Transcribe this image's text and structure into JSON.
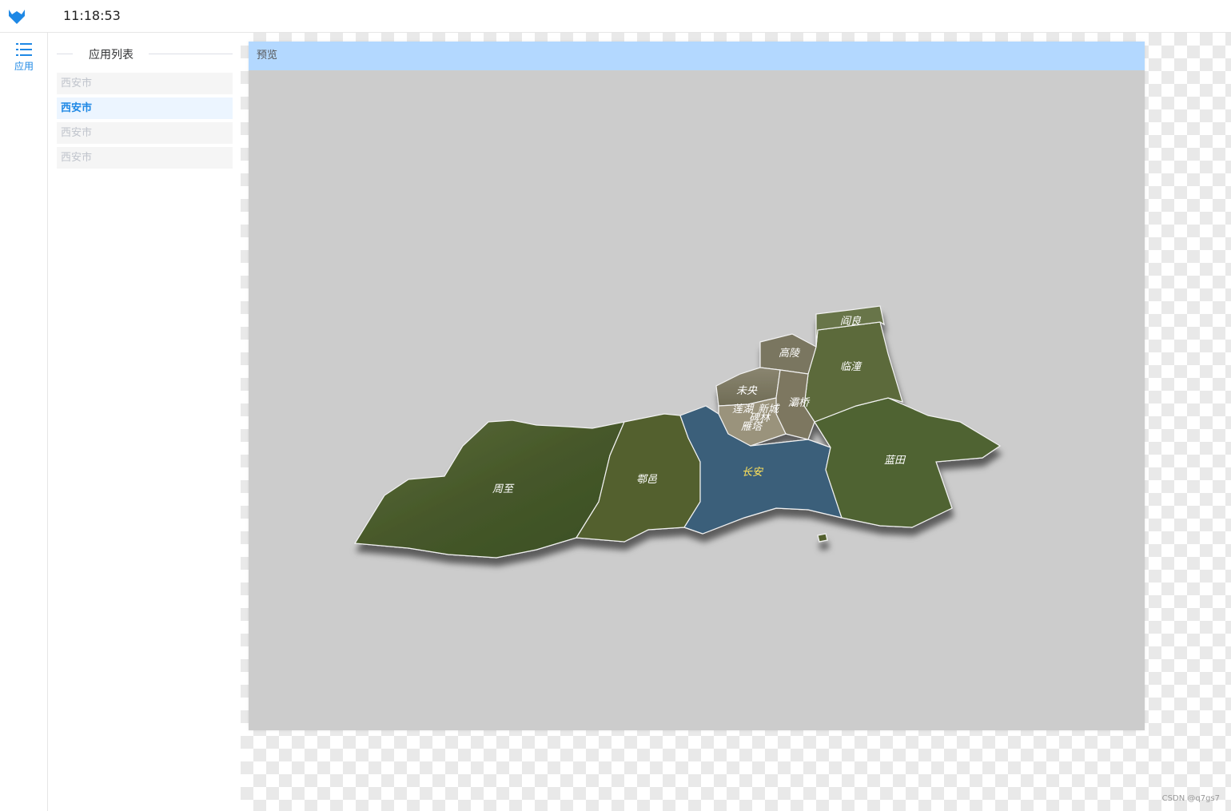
{
  "header": {
    "time": "11:18:53",
    "logo": "fox-logo-icon"
  },
  "sidebar": {
    "nav_label": "应用",
    "nav_icon": "list-icon"
  },
  "app_list": {
    "title": "应用列表",
    "items": [
      {
        "label": "西安市",
        "active": false
      },
      {
        "label": "西安市",
        "active": true
      },
      {
        "label": "西安市",
        "active": false
      },
      {
        "label": "西安市",
        "active": false
      }
    ]
  },
  "preview": {
    "title": "预览",
    "map": {
      "districts": [
        "阎良",
        "高陵",
        "临潼",
        "未央",
        "灞桥",
        "莲湖",
        "新城",
        "碑林",
        "雁塔",
        "周至",
        "鄠邑",
        "长安",
        "蓝田"
      ],
      "selected": "长安"
    }
  },
  "watermark": "CSDN @q7gs7",
  "colors": {
    "accent": "#1e88e5",
    "preview_header": "#b3d8ff",
    "selected_label": "#ffe25a",
    "selected_region": "#3a5f7a"
  }
}
